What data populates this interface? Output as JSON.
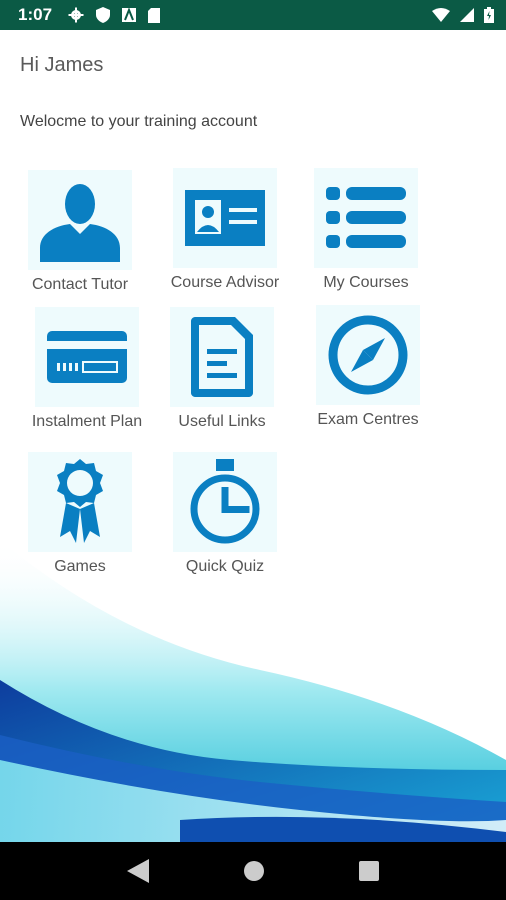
{
  "status_bar": {
    "time": "1:07"
  },
  "greeting": "Hi James",
  "welcome": "Welocme to your training account",
  "tiles": [
    {
      "label": "Contact Tutor"
    },
    {
      "label": "Course Advisor"
    },
    {
      "label": "My Courses"
    },
    {
      "label": "Instalment Plan"
    },
    {
      "label": "Useful Links"
    },
    {
      "label": "Exam Centres"
    },
    {
      "label": "Games"
    },
    {
      "label": "Quick Quiz"
    }
  ],
  "colors": {
    "accent": "#0a7fc2",
    "status_bar": "#0b5a45",
    "tile_bg": "#eefbfd"
  }
}
